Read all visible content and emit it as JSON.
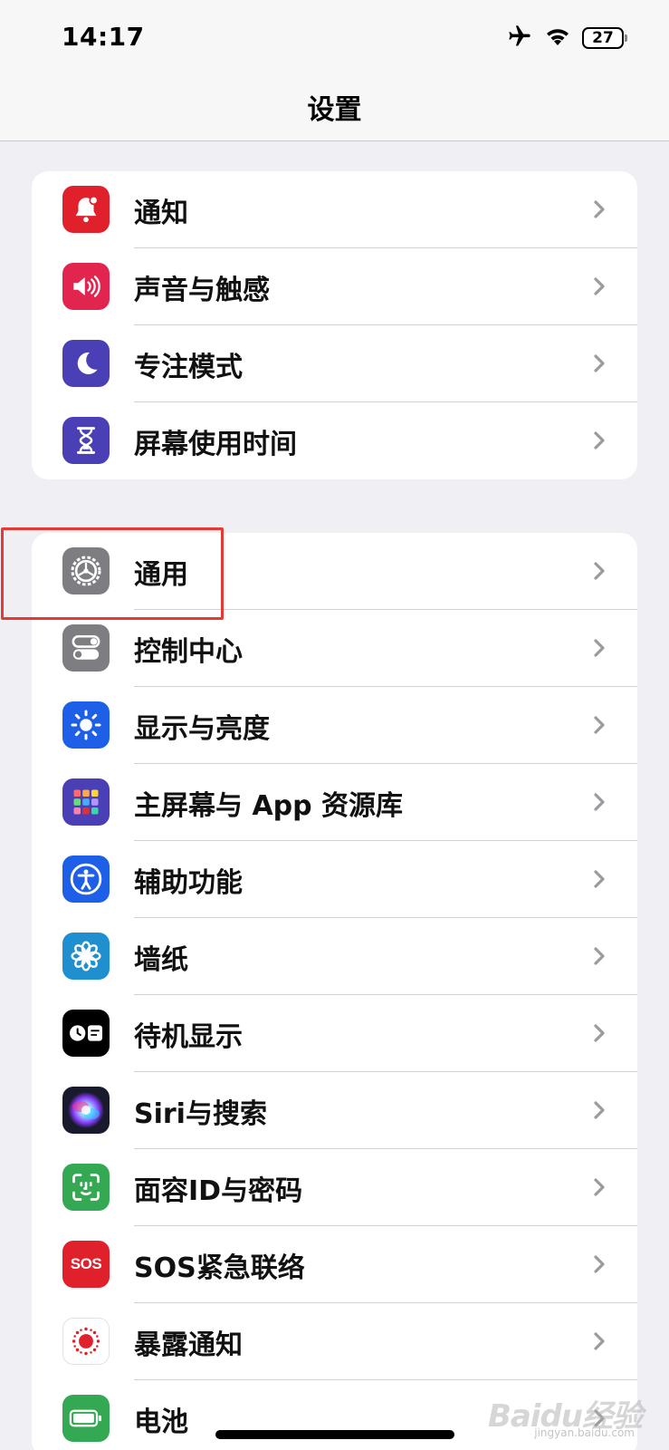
{
  "status_bar": {
    "time": "14:17",
    "battery": "27",
    "icons": [
      "airplane-icon",
      "wifi-icon",
      "battery-icon"
    ]
  },
  "nav": {
    "title": "设置"
  },
  "groups": [
    {
      "items": [
        {
          "label": "通知",
          "icon": "notification-bell-icon",
          "color": "#e0202a"
        },
        {
          "label": "声音与触感",
          "icon": "speaker-icon",
          "color": "#e2254e"
        },
        {
          "label": "专注模式",
          "icon": "moon-icon",
          "color": "#4a3fb5"
        },
        {
          "label": "屏幕使用时间",
          "icon": "hourglass-icon",
          "color": "#4a3fb5"
        }
      ]
    },
    {
      "items": [
        {
          "label": "通用",
          "icon": "gear-icon",
          "color": "#7d7d82",
          "highlighted": true
        },
        {
          "label": "控制中心",
          "icon": "toggles-icon",
          "color": "#7d7d82"
        },
        {
          "label": "显示与亮度",
          "icon": "sun-icon",
          "color": "#1d5fe6"
        },
        {
          "label": "主屏幕与 App 资源库",
          "icon": "app-grid-icon",
          "color": "#4a3fb5"
        },
        {
          "label": "辅助功能",
          "icon": "accessibility-icon",
          "color": "#1d5fe6"
        },
        {
          "label": "墙纸",
          "icon": "flower-icon",
          "color": "#1f8fd0"
        },
        {
          "label": "待机显示",
          "icon": "standby-icon",
          "color": "#000000"
        },
        {
          "label": "Siri与搜索",
          "icon": "siri-icon",
          "color": "#1a1a2e"
        },
        {
          "label": "面容ID与密码",
          "icon": "face-id-icon",
          "color": "#34a853"
        },
        {
          "label": "SOS紧急联络",
          "icon": "sos-icon",
          "color": "#e0202a",
          "icon_text": "SOS"
        },
        {
          "label": "暴露通知",
          "icon": "exposure-icon",
          "color": "#ffffff"
        },
        {
          "label": "电池",
          "icon": "battery-icon",
          "color": "#34a853"
        }
      ]
    }
  ],
  "watermark": {
    "text": "Baidu经验",
    "sub": "jingyan.baidu.com"
  }
}
